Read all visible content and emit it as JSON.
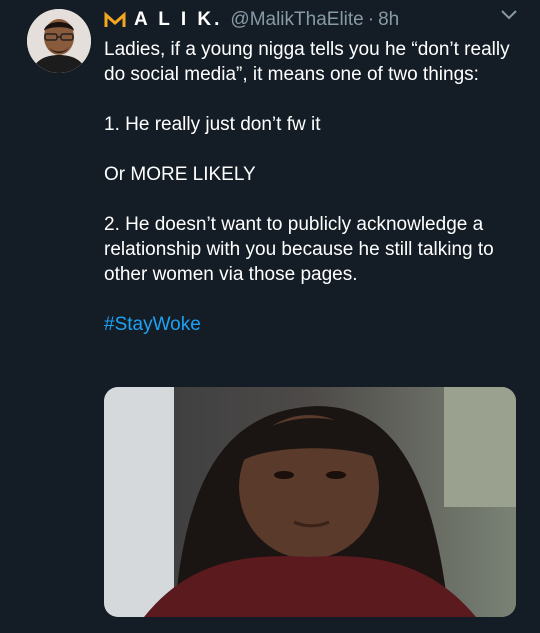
{
  "tweet": {
    "display_name": "A L I K.",
    "handle": "@MalikThaElite",
    "separator": "·",
    "timestamp": "8h",
    "lines": {
      "line1": "Ladies, if a young nigga tells you he “don’t really do social media”, it means one of two things:",
      "line2": "1. He really just don’t fw it",
      "line3": "Or MORE LIKELY",
      "line4": "2. He doesn’t want to publicly acknowledge a relationship with you because he still talking to other women via those pages."
    },
    "hashtag": "#StayWoke"
  },
  "colors": {
    "background": "#141d26",
    "text": "#ffffff",
    "secondary_text": "#8899a6",
    "link": "#1da1f2",
    "logo": "#f5a623"
  },
  "icons": {
    "logo": "crown-m-icon",
    "caret": "chevron-down-icon"
  }
}
